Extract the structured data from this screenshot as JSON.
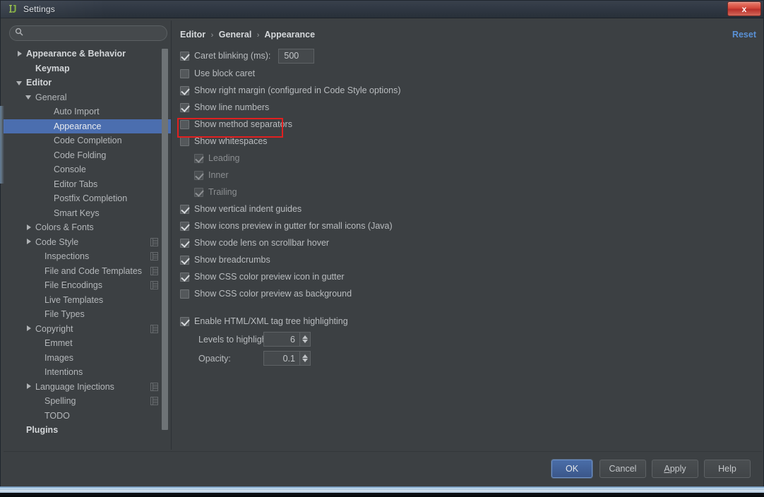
{
  "window": {
    "title": "Settings",
    "app_icon": "intellij-idea-icon",
    "close_label": "x"
  },
  "search": {
    "value": "",
    "placeholder": "",
    "icon": "search-icon"
  },
  "sidebar": {
    "items": [
      {
        "label": "Appearance & Behavior",
        "indent": 0,
        "twisty": "collapsed",
        "bold": true,
        "selected": false,
        "scope_icon": false
      },
      {
        "label": "Keymap",
        "indent": 1,
        "twisty": "none",
        "bold": true,
        "selected": false,
        "scope_icon": false
      },
      {
        "label": "Editor",
        "indent": 0,
        "twisty": "expanded",
        "bold": true,
        "selected": false,
        "scope_icon": false
      },
      {
        "label": "General",
        "indent": 1,
        "twisty": "expanded",
        "bold": false,
        "selected": false,
        "scope_icon": false
      },
      {
        "label": "Auto Import",
        "indent": 3,
        "twisty": "none",
        "bold": false,
        "selected": false,
        "scope_icon": false
      },
      {
        "label": "Appearance",
        "indent": 3,
        "twisty": "none",
        "bold": false,
        "selected": true,
        "scope_icon": false
      },
      {
        "label": "Code Completion",
        "indent": 3,
        "twisty": "none",
        "bold": false,
        "selected": false,
        "scope_icon": false
      },
      {
        "label": "Code Folding",
        "indent": 3,
        "twisty": "none",
        "bold": false,
        "selected": false,
        "scope_icon": false
      },
      {
        "label": "Console",
        "indent": 3,
        "twisty": "none",
        "bold": false,
        "selected": false,
        "scope_icon": false
      },
      {
        "label": "Editor Tabs",
        "indent": 3,
        "twisty": "none",
        "bold": false,
        "selected": false,
        "scope_icon": false
      },
      {
        "label": "Postfix Completion",
        "indent": 3,
        "twisty": "none",
        "bold": false,
        "selected": false,
        "scope_icon": false
      },
      {
        "label": "Smart Keys",
        "indent": 3,
        "twisty": "none",
        "bold": false,
        "selected": false,
        "scope_icon": false
      },
      {
        "label": "Colors & Fonts",
        "indent": 1,
        "twisty": "collapsed",
        "bold": false,
        "selected": false,
        "scope_icon": false
      },
      {
        "label": "Code Style",
        "indent": 1,
        "twisty": "collapsed",
        "bold": false,
        "selected": false,
        "scope_icon": true
      },
      {
        "label": "Inspections",
        "indent": 2,
        "twisty": "none",
        "bold": false,
        "selected": false,
        "scope_icon": true
      },
      {
        "label": "File and Code Templates",
        "indent": 2,
        "twisty": "none",
        "bold": false,
        "selected": false,
        "scope_icon": true
      },
      {
        "label": "File Encodings",
        "indent": 2,
        "twisty": "none",
        "bold": false,
        "selected": false,
        "scope_icon": true
      },
      {
        "label": "Live Templates",
        "indent": 2,
        "twisty": "none",
        "bold": false,
        "selected": false,
        "scope_icon": false
      },
      {
        "label": "File Types",
        "indent": 2,
        "twisty": "none",
        "bold": false,
        "selected": false,
        "scope_icon": false
      },
      {
        "label": "Copyright",
        "indent": 1,
        "twisty": "collapsed",
        "bold": false,
        "selected": false,
        "scope_icon": true
      },
      {
        "label": "Emmet",
        "indent": 2,
        "twisty": "none",
        "bold": false,
        "selected": false,
        "scope_icon": false
      },
      {
        "label": "Images",
        "indent": 2,
        "twisty": "none",
        "bold": false,
        "selected": false,
        "scope_icon": false
      },
      {
        "label": "Intentions",
        "indent": 2,
        "twisty": "none",
        "bold": false,
        "selected": false,
        "scope_icon": false
      },
      {
        "label": "Language Injections",
        "indent": 1,
        "twisty": "collapsed",
        "bold": false,
        "selected": false,
        "scope_icon": true
      },
      {
        "label": "Spelling",
        "indent": 2,
        "twisty": "none",
        "bold": false,
        "selected": false,
        "scope_icon": true
      },
      {
        "label": "TODO",
        "indent": 2,
        "twisty": "none",
        "bold": false,
        "selected": false,
        "scope_icon": false
      },
      {
        "label": "Plugins",
        "indent": 0,
        "twisty": "none",
        "bold": true,
        "selected": false,
        "scope_icon": false
      }
    ]
  },
  "breadcrumb": {
    "part1": "Editor",
    "part2": "General",
    "part3": "Appearance",
    "separator": "›"
  },
  "reset": {
    "label": "Reset"
  },
  "options": {
    "caret_blinking": {
      "label": "Caret blinking (ms):",
      "checked": true,
      "value": "500"
    },
    "rows": [
      {
        "label": "Use block caret",
        "checked": false,
        "indent": 0,
        "dim": false
      },
      {
        "label": "Show right margin (configured in Code Style options)",
        "checked": true,
        "indent": 0,
        "dim": false
      },
      {
        "label": "Show line numbers",
        "checked": true,
        "indent": 0,
        "dim": false
      },
      {
        "label": "Show method separators",
        "checked": false,
        "indent": 0,
        "dim": false
      },
      {
        "label": "Show whitespaces",
        "checked": false,
        "indent": 0,
        "dim": false
      },
      {
        "label": "Leading",
        "checked": true,
        "indent": 1,
        "dim": true
      },
      {
        "label": "Inner",
        "checked": true,
        "indent": 1,
        "dim": true
      },
      {
        "label": "Trailing",
        "checked": true,
        "indent": 1,
        "dim": true
      },
      {
        "label": "Show vertical indent guides",
        "checked": true,
        "indent": 0,
        "dim": false
      },
      {
        "label": "Show icons preview in gutter for small icons (Java)",
        "checked": true,
        "indent": 0,
        "dim": false
      },
      {
        "label": "Show code lens on scrollbar hover",
        "checked": true,
        "indent": 0,
        "dim": false
      },
      {
        "label": "Show breadcrumbs",
        "checked": true,
        "indent": 0,
        "dim": false
      },
      {
        "label": "Show CSS color preview icon in gutter",
        "checked": true,
        "indent": 0,
        "dim": false
      },
      {
        "label": "Show CSS color preview as background",
        "checked": false,
        "indent": 0,
        "dim": false
      }
    ],
    "tag_tree": {
      "label": "Enable HTML/XML tag tree highlighting",
      "checked": true,
      "levels_label": "Levels to highlight:",
      "levels_value": "6",
      "opacity_label": "Opacity:",
      "opacity_value": "0.1"
    }
  },
  "buttons": {
    "ok": "OK",
    "cancel": "Cancel",
    "apply_pre": "A",
    "apply_post": "pply",
    "help": "Help"
  },
  "annotation": {
    "highlight_target": "Show line numbers",
    "color": "#e02020"
  },
  "colors": {
    "panel_bg": "#3c4043",
    "selection": "#4b6eaf",
    "link": "#5a91d6",
    "text": "#b9bcbf",
    "close_button": "#d4473a"
  }
}
